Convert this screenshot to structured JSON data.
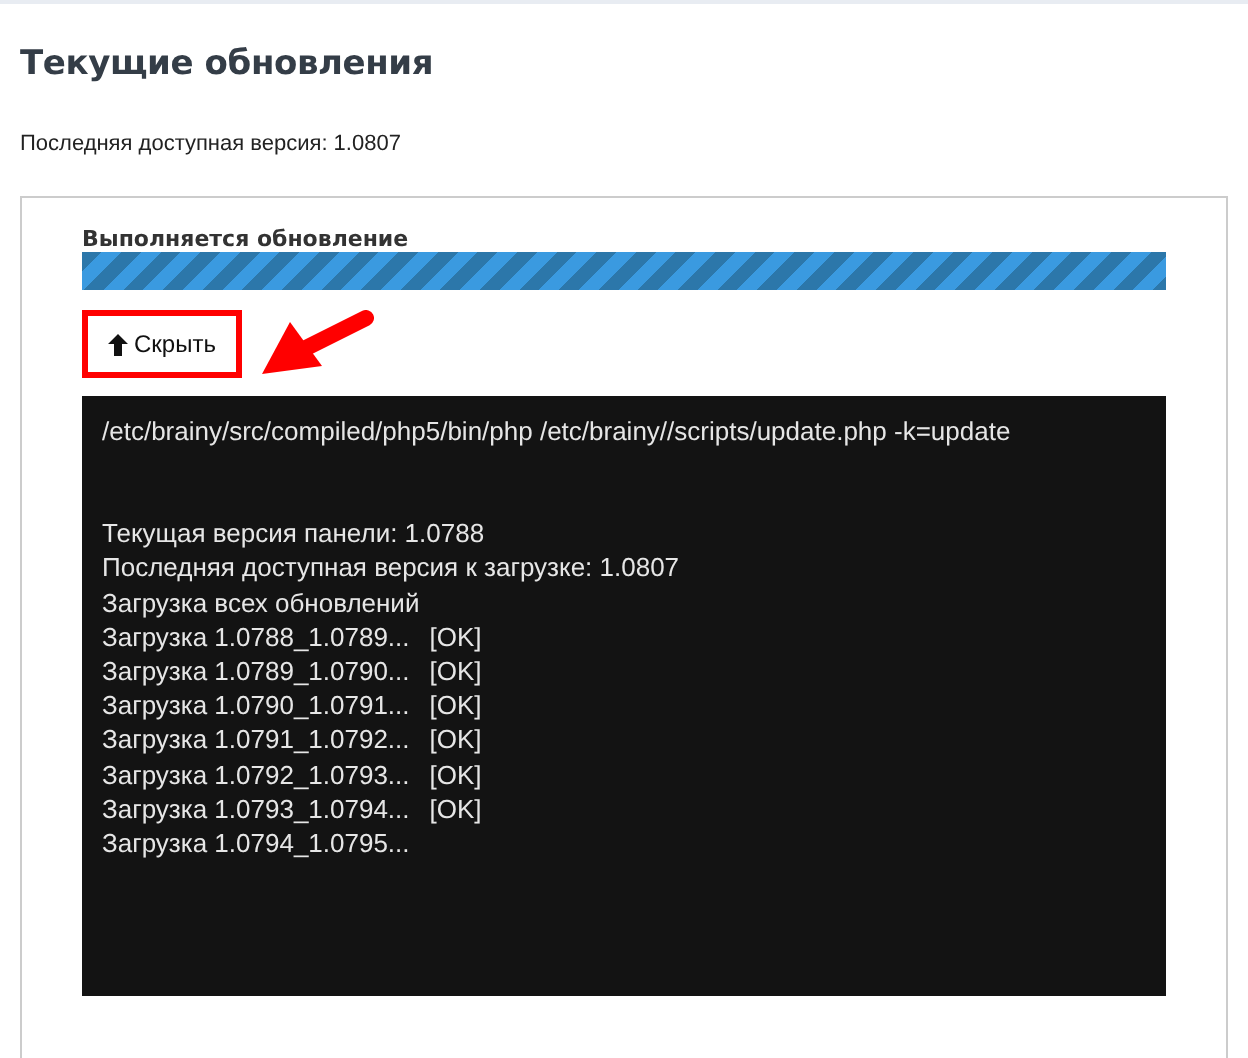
{
  "title": "Текущие обновления",
  "latest_version": "Последняя доступная версия: 1.0807",
  "progress": {
    "label": "Выполняется обновление",
    "level": 1
  },
  "hide_button": {
    "label": "Скрыть",
    "highlighted": true
  },
  "console": {
    "command": "/etc/brainy/src/compiled/php5/bin/php /etc/brainy//scripts/update.php -k=update",
    "lines": [
      {
        "text": "Текущая версия панели: 1.0788"
      },
      {
        "text": "Последняя доступная версия к загрузке: 1.0807"
      },
      {
        "text": "Загрузка всех обновлений"
      },
      {
        "text": "Загрузка 1.0788_1.0789...",
        "status": "[OK]"
      },
      {
        "text": "Загрузка 1.0789_1.0790...",
        "status": "[OK]"
      },
      {
        "text": "Загрузка 1.0790_1.0791...",
        "status": "[OK]"
      },
      {
        "text": "Загрузка 1.0791_1.0792...",
        "status": "[OK]"
      },
      {
        "text": "Загрузка 1.0792_1.0793...",
        "status": "[OK]"
      },
      {
        "text": "Загрузка 1.0793_1.0794...",
        "status": "[OK]"
      },
      {
        "text": "Загрузка 1.0794_1.0795..."
      }
    ]
  }
}
